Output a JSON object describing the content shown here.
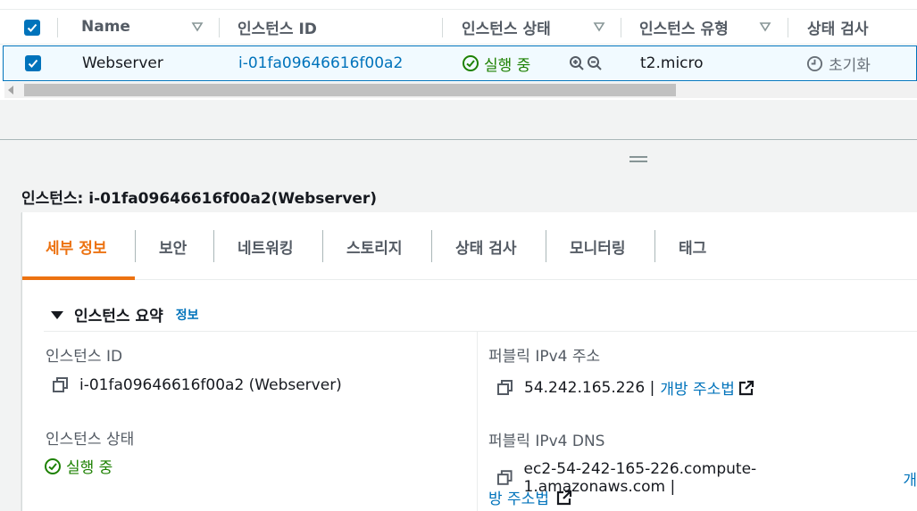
{
  "table": {
    "headers": {
      "name": "Name",
      "instance_id": "인스턴스 ID",
      "instance_state": "인스턴스 상태",
      "instance_type": "인스턴스 유형",
      "status_check": "상태 검사"
    },
    "row": {
      "name": "Webserver",
      "instance_id": "i-01fa09646616f00a2",
      "state": "실행 중",
      "type": "t2.micro",
      "status": "초기화"
    }
  },
  "details": {
    "title": "인스턴스: i-01fa09646616f00a2(Webserver)",
    "tabs": [
      "세부 정보",
      "보안",
      "네트워킹",
      "스토리지",
      "상태 검사",
      "모니터링",
      "태그"
    ],
    "summary_title": "인스턴스 요약",
    "info_link": "정보",
    "fields": {
      "instance_id_label": "인스턴스 ID",
      "instance_id_value": "i-01fa09646616f00a2 (Webserver)",
      "instance_state_label": "인스턴스 상태",
      "instance_state_value": "실행 중",
      "public_ipv4_label": "퍼블릭 IPv4 주소",
      "public_ipv4_value": "54.242.165.226 |",
      "public_ipv4_link": "개방 주소법",
      "public_dns_label": "퍼블릭 IPv4 DNS",
      "public_dns_value": "ec2-54-242-165-226.compute-1.amazonaws.com |",
      "public_dns_link_part1": "개",
      "public_dns_link_part2": "방 주소법"
    }
  },
  "colors": {
    "accent_blue": "#0073bb",
    "active_tab": "#ec7211",
    "success_green": "#1d8102"
  }
}
